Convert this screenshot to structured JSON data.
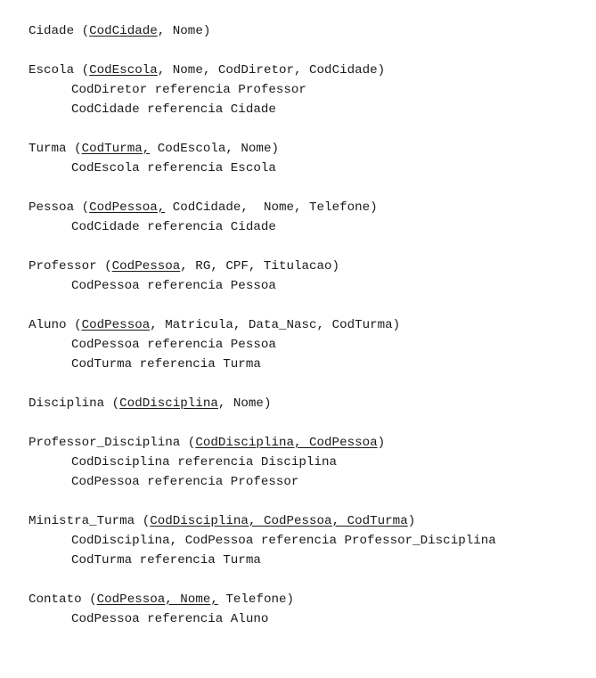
{
  "relations": [
    {
      "name": "Cidade",
      "key": "CodCidade",
      "rest": ", Nome)",
      "refs": []
    },
    {
      "name": "Escola",
      "key": "CodEscola",
      "rest": ", Nome, CodDiretor, CodCidade)",
      "refs": [
        "CodDiretor referencia Professor",
        "CodCidade referencia Cidade"
      ]
    },
    {
      "name": "Turma",
      "key": "CodTurma,",
      "rest": " CodEscola, Nome)",
      "refs": [
        "CodEscola referencia Escola"
      ]
    },
    {
      "name": "Pessoa",
      "key": "CodPessoa,",
      "rest": " CodCidade,  Nome, Telefone)",
      "refs": [
        "CodCidade referencia Cidade"
      ]
    },
    {
      "name": "Professor",
      "key": "CodPessoa",
      "rest": ", RG, CPF, Titulacao)",
      "refs": [
        "CodPessoa referencia Pessoa"
      ]
    },
    {
      "name": "Aluno",
      "key": "CodPessoa",
      "rest": ", Matricula, Data_Nasc, CodTurma)",
      "refs": [
        "CodPessoa referencia Pessoa",
        "CodTurma referencia Turma"
      ]
    },
    {
      "name": "Disciplina",
      "key": "CodDisciplina",
      "rest": ", Nome)",
      "refs": []
    },
    {
      "name": "Professor_Disciplina",
      "key": "CodDisciplina, CodPessoa",
      "rest": ")",
      "refs": [
        "CodDisciplina referencia Disciplina",
        "CodPessoa referencia Professor"
      ]
    },
    {
      "name": "Ministra_Turma",
      "key": "CodDisciplina, CodPessoa, CodTurma",
      "rest": ")",
      "refs": [
        "CodDisciplina, CodPessoa referencia Professor_Disciplina",
        "CodTurma referencia Turma"
      ]
    },
    {
      "name": "Contato",
      "key": "CodPessoa, Nome,",
      "rest": " Telefone)",
      "refs": [
        "CodPessoa referencia Aluno"
      ]
    }
  ]
}
